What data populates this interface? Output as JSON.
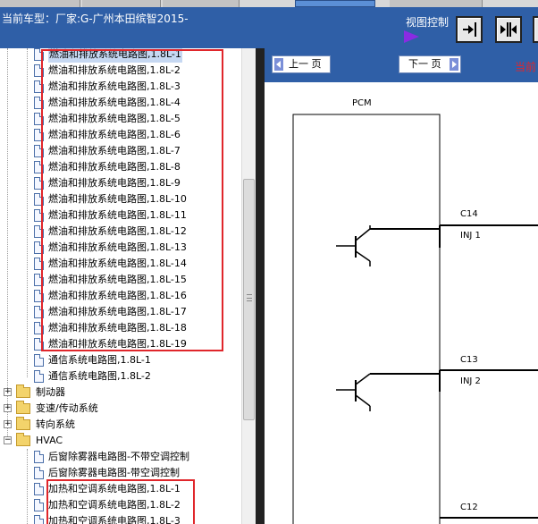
{
  "header": {
    "vehicle_info": "当前车型：厂家:G-广州本田缤智2015-",
    "view_control_label": "视图控制"
  },
  "tree": {
    "fuel_items": [
      "燃油和排放系统电路图,1.8L-1",
      "燃油和排放系统电路图,1.8L-2",
      "燃油和排放系统电路图,1.8L-3",
      "燃油和排放系统电路图,1.8L-4",
      "燃油和排放系统电路图,1.8L-5",
      "燃油和排放系统电路图,1.8L-6",
      "燃油和排放系统电路图,1.8L-7",
      "燃油和排放系统电路图,1.8L-8",
      "燃油和排放系统电路图,1.8L-9",
      "燃油和排放系统电路图,1.8L-10",
      "燃油和排放系统电路图,1.8L-11",
      "燃油和排放系统电路图,1.8L-12",
      "燃油和排放系统电路图,1.8L-13",
      "燃油和排放系统电路图,1.8L-14",
      "燃油和排放系统电路图,1.8L-15",
      "燃油和排放系统电路图,1.8L-16",
      "燃油和排放系统电路图,1.8L-17",
      "燃油和排放系统电路图,1.8L-18",
      "燃油和排放系统电路图,1.8L-19"
    ],
    "comm_items": [
      "通信系统电路图,1.8L-1",
      "通信系统电路图,1.8L-2"
    ],
    "folders": [
      {
        "label": "制动器",
        "expander": "+"
      },
      {
        "label": "变速/传动系统",
        "expander": "+"
      },
      {
        "label": "转向系统",
        "expander": "+"
      },
      {
        "label": "HVAC",
        "expander": "−"
      }
    ],
    "hvac_items": [
      "后窗除雾器电路图-不带空调控制",
      "后窗除雾器电路图-带空调控制",
      "加热和空调系统电路图,1.8L-1",
      "加热和空调系统电路图,1.8L-2",
      "加热和空调系统电路图,1.8L-3"
    ]
  },
  "diagram": {
    "prev_page_label": "上一 页",
    "next_page_label": "下一 页",
    "current_label": "当前",
    "pcm_label": "PCM",
    "connectors": [
      {
        "pin": "C14",
        "name": "INJ 1"
      },
      {
        "pin": "C13",
        "name": "INJ 2"
      },
      {
        "pin": "C12",
        "name": ""
      }
    ]
  },
  "colors": {
    "header_blue": "#2f5fa7",
    "highlight_red": "#e0262b",
    "selection_blue": "#c6d8f2",
    "view_arrow_purple": "#8a2be2"
  }
}
